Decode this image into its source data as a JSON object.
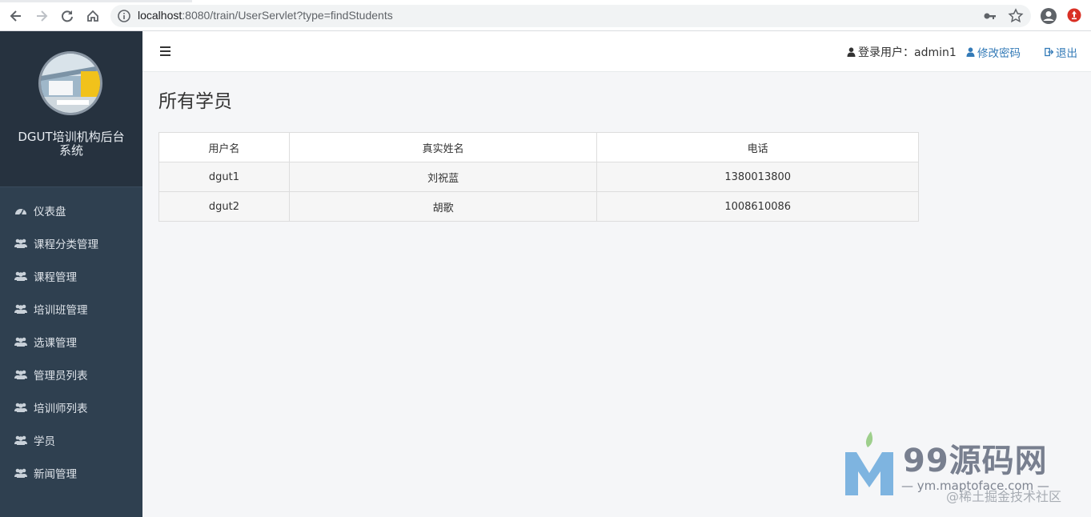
{
  "browser": {
    "url_host": "localhost",
    "url_rest": ":8080/train/UserServlet?type=findStudents"
  },
  "sidebar": {
    "brand_title": "DGUT培训机构后台系统",
    "items": [
      {
        "label": "仪表盘",
        "icon": "dashboard-icon"
      },
      {
        "label": "课程分类管理",
        "icon": "users-icon"
      },
      {
        "label": "课程管理",
        "icon": "users-icon"
      },
      {
        "label": "培训班管理",
        "icon": "users-icon"
      },
      {
        "label": "选课管理",
        "icon": "users-icon"
      },
      {
        "label": "管理员列表",
        "icon": "users-icon"
      },
      {
        "label": "培训师列表",
        "icon": "users-icon"
      },
      {
        "label": "学员",
        "icon": "users-icon"
      },
      {
        "label": "新闻管理",
        "icon": "users-icon"
      }
    ]
  },
  "header": {
    "user_label": "登录用户：admin1",
    "change_password": "修改密码",
    "logout": "退出"
  },
  "main": {
    "title": "所有学员",
    "columns": [
      "用户名",
      "真实姓名",
      "电话"
    ],
    "rows": [
      [
        "dgut1",
        "刘祝蓝",
        "1380013800"
      ],
      [
        "dgut2",
        "胡歌",
        "1008610086"
      ]
    ]
  },
  "watermark": {
    "brand": "99源码网",
    "url": "— ym.maptoface.com —",
    "sub": "@稀土掘金技术社区"
  },
  "colors": {
    "sidebar_bg": "#2f4050",
    "brand_bg": "#26323f",
    "link": "#337ab7"
  }
}
